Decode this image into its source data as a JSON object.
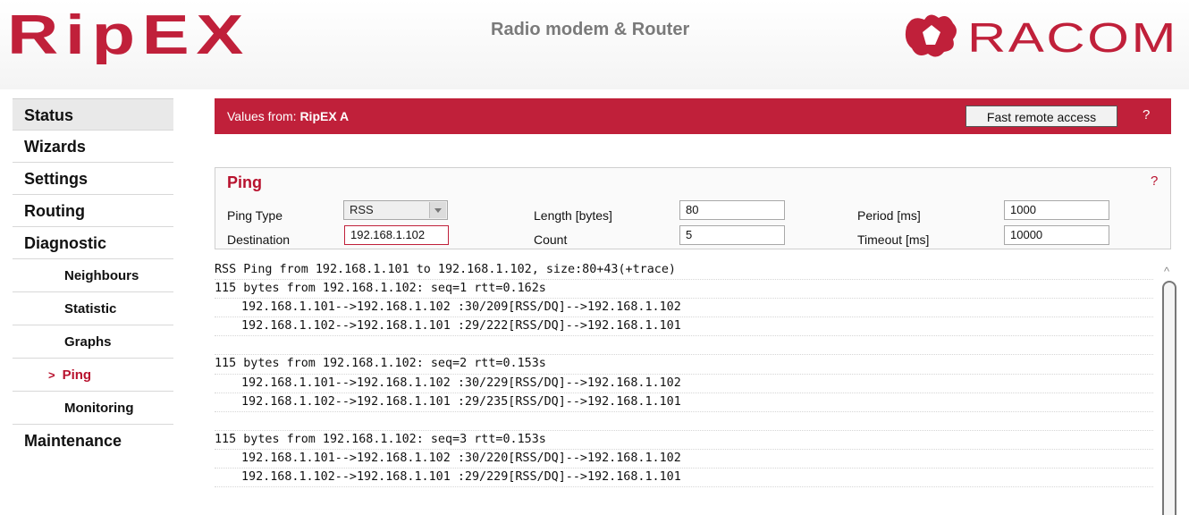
{
  "header": {
    "logo_text": "RipEX",
    "tagline": "Radio modem & Router",
    "brand": "RACOM"
  },
  "colors": {
    "accent": "#c0203a",
    "logo": "#c0203a"
  },
  "sidebar": {
    "items": [
      {
        "label": "Status"
      },
      {
        "label": "Wizards"
      },
      {
        "label": "Settings"
      },
      {
        "label": "Routing"
      },
      {
        "label": "Diagnostic"
      },
      {
        "label": "Neighbours"
      },
      {
        "label": "Statistic"
      },
      {
        "label": "Graphs"
      },
      {
        "label": "Ping",
        "active": true,
        "marker": ">"
      },
      {
        "label": "Monitoring"
      },
      {
        "label": "Maintenance"
      }
    ]
  },
  "bar": {
    "values_from_label": "Values from: ",
    "device": "RipEX A",
    "fast_remote_access": "Fast remote access",
    "help": "?"
  },
  "ping": {
    "title": "Ping",
    "help": "?",
    "ping_type_label": "Ping Type",
    "ping_type_value": "RSS",
    "destination_label": "Destination",
    "destination_value": "192.168.1.102",
    "length_label": "Length [bytes]",
    "length_value": "80",
    "count_label": "Count",
    "count_value": "5",
    "period_label": "Period [ms]",
    "period_value": "1000",
    "timeout_label": "Timeout [ms]",
    "timeout_value": "10000"
  },
  "output": {
    "lines": [
      "RSS Ping from 192.168.1.101 to 192.168.1.102, size:80+43(+trace)",
      "115 bytes from 192.168.1.102: seq=1 rtt=0.162s",
      "192.168.1.101-->192.168.1.102 :30/209[RSS/DQ]-->192.168.1.102",
      "192.168.1.102-->192.168.1.101 :29/222[RSS/DQ]-->192.168.1.101",
      "",
      "115 bytes from 192.168.1.102: seq=2 rtt=0.153s",
      "192.168.1.101-->192.168.1.102 :30/229[RSS/DQ]-->192.168.1.102",
      "192.168.1.102-->192.168.1.101 :29/235[RSS/DQ]-->192.168.1.101",
      "",
      "115 bytes from 192.168.1.102: seq=3 rtt=0.153s",
      "192.168.1.101-->192.168.1.102 :30/220[RSS/DQ]-->192.168.1.102",
      "192.168.1.102-->192.168.1.101 :29/229[RSS/DQ]-->192.168.1.101"
    ]
  }
}
